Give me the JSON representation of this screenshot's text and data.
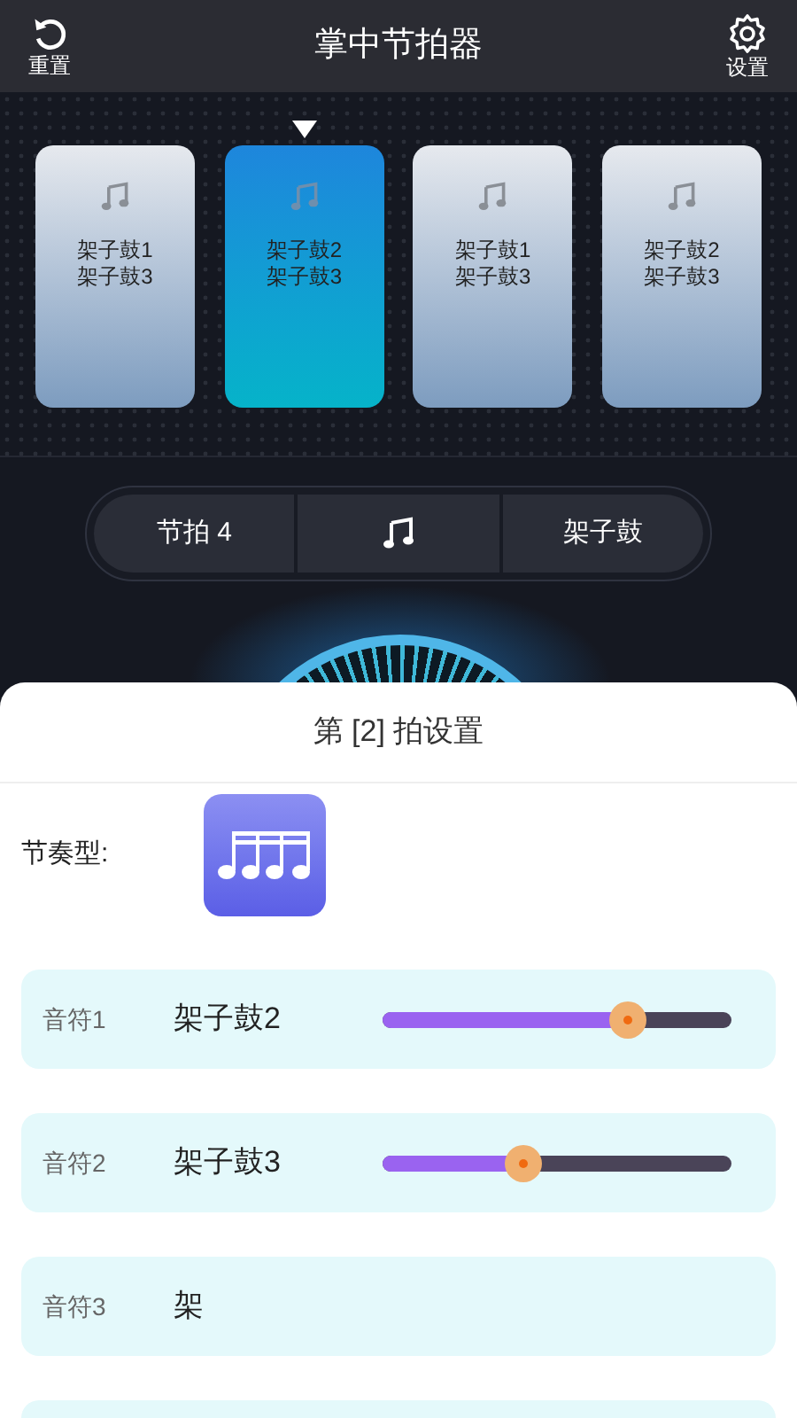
{
  "header": {
    "title": "掌中节拍器",
    "reset_label": "重置",
    "settings_label": "设置"
  },
  "beats": [
    {
      "lines": [
        "架子鼓1",
        "架子鼓3"
      ],
      "selected": false
    },
    {
      "lines": [
        "架子鼓2",
        "架子鼓3"
      ],
      "selected": true
    },
    {
      "lines": [
        "架子鼓1",
        "架子鼓3"
      ],
      "selected": false
    },
    {
      "lines": [
        "架子鼓2",
        "架子鼓3"
      ],
      "selected": false
    }
  ],
  "controls": {
    "beat_count": "节拍 4",
    "instrument": "架子鼓"
  },
  "sheet": {
    "title": "第 [2] 拍设置",
    "rhythm_label": "节奏型:",
    "notes": [
      {
        "label": "音符1",
        "sound": "架子鼓2",
        "level": 0.7
      },
      {
        "label": "音符2",
        "sound": "架子鼓3",
        "level": 0.4
      },
      {
        "label": "音符3",
        "sound": "架"
      }
    ]
  }
}
